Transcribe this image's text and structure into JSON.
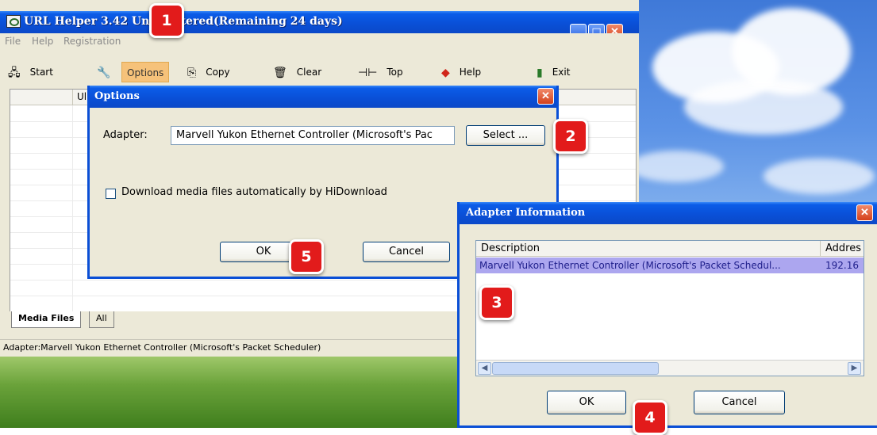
{
  "main_window": {
    "title": "URL Helper 3.42 Unregistered(Remaining 24 days)",
    "menu": [
      "File",
      "Help",
      "Registration"
    ],
    "toolbar": [
      {
        "label": "Start",
        "icon": "network-icon"
      },
      {
        "label": "Options",
        "icon": "wrench-icon"
      },
      {
        "label": "Copy",
        "icon": "copy-icon"
      },
      {
        "label": "Clear",
        "icon": "trash-icon"
      },
      {
        "label": "Top",
        "icon": "pin-icon"
      },
      {
        "label": "Help",
        "icon": "book-icon"
      },
      {
        "label": "Exit",
        "icon": "door-icon"
      }
    ],
    "list_column_partial": "Ul",
    "tabs": [
      "Media Files",
      "All"
    ],
    "status_text": "Adapter:Marvell Yukon Ethernet Controller (Microsoft's Packet Scheduler)"
  },
  "options_dialog": {
    "title": "Options",
    "adapter_label": "Adapter:",
    "adapter_value": "Marvell Yukon Ethernet Controller (Microsoft's Pac",
    "select_button": "Select ...",
    "checkbox_label": "Download media files automatically by HiDownload",
    "checkbox_checked": false,
    "ok_button": "OK",
    "cancel_button": "Cancel"
  },
  "adapter_dialog": {
    "title": "Adapter Information",
    "columns": [
      "Description",
      "Addres"
    ],
    "rows": [
      {
        "description": "Marvell Yukon Ethernet Controller (Microsoft's Packet Schedul...",
        "address": "192.16"
      }
    ],
    "ok_button": "OK",
    "cancel_button": "Cancel"
  },
  "callouts": [
    "1",
    "2",
    "3",
    "4",
    "5"
  ],
  "colors": {
    "titlebar_blue": "#0a4fd6",
    "window_face": "#ece9d8",
    "badge_red": "#e21b1b",
    "selection": "#aca6ef",
    "options_highlight": "#f6c27a"
  }
}
